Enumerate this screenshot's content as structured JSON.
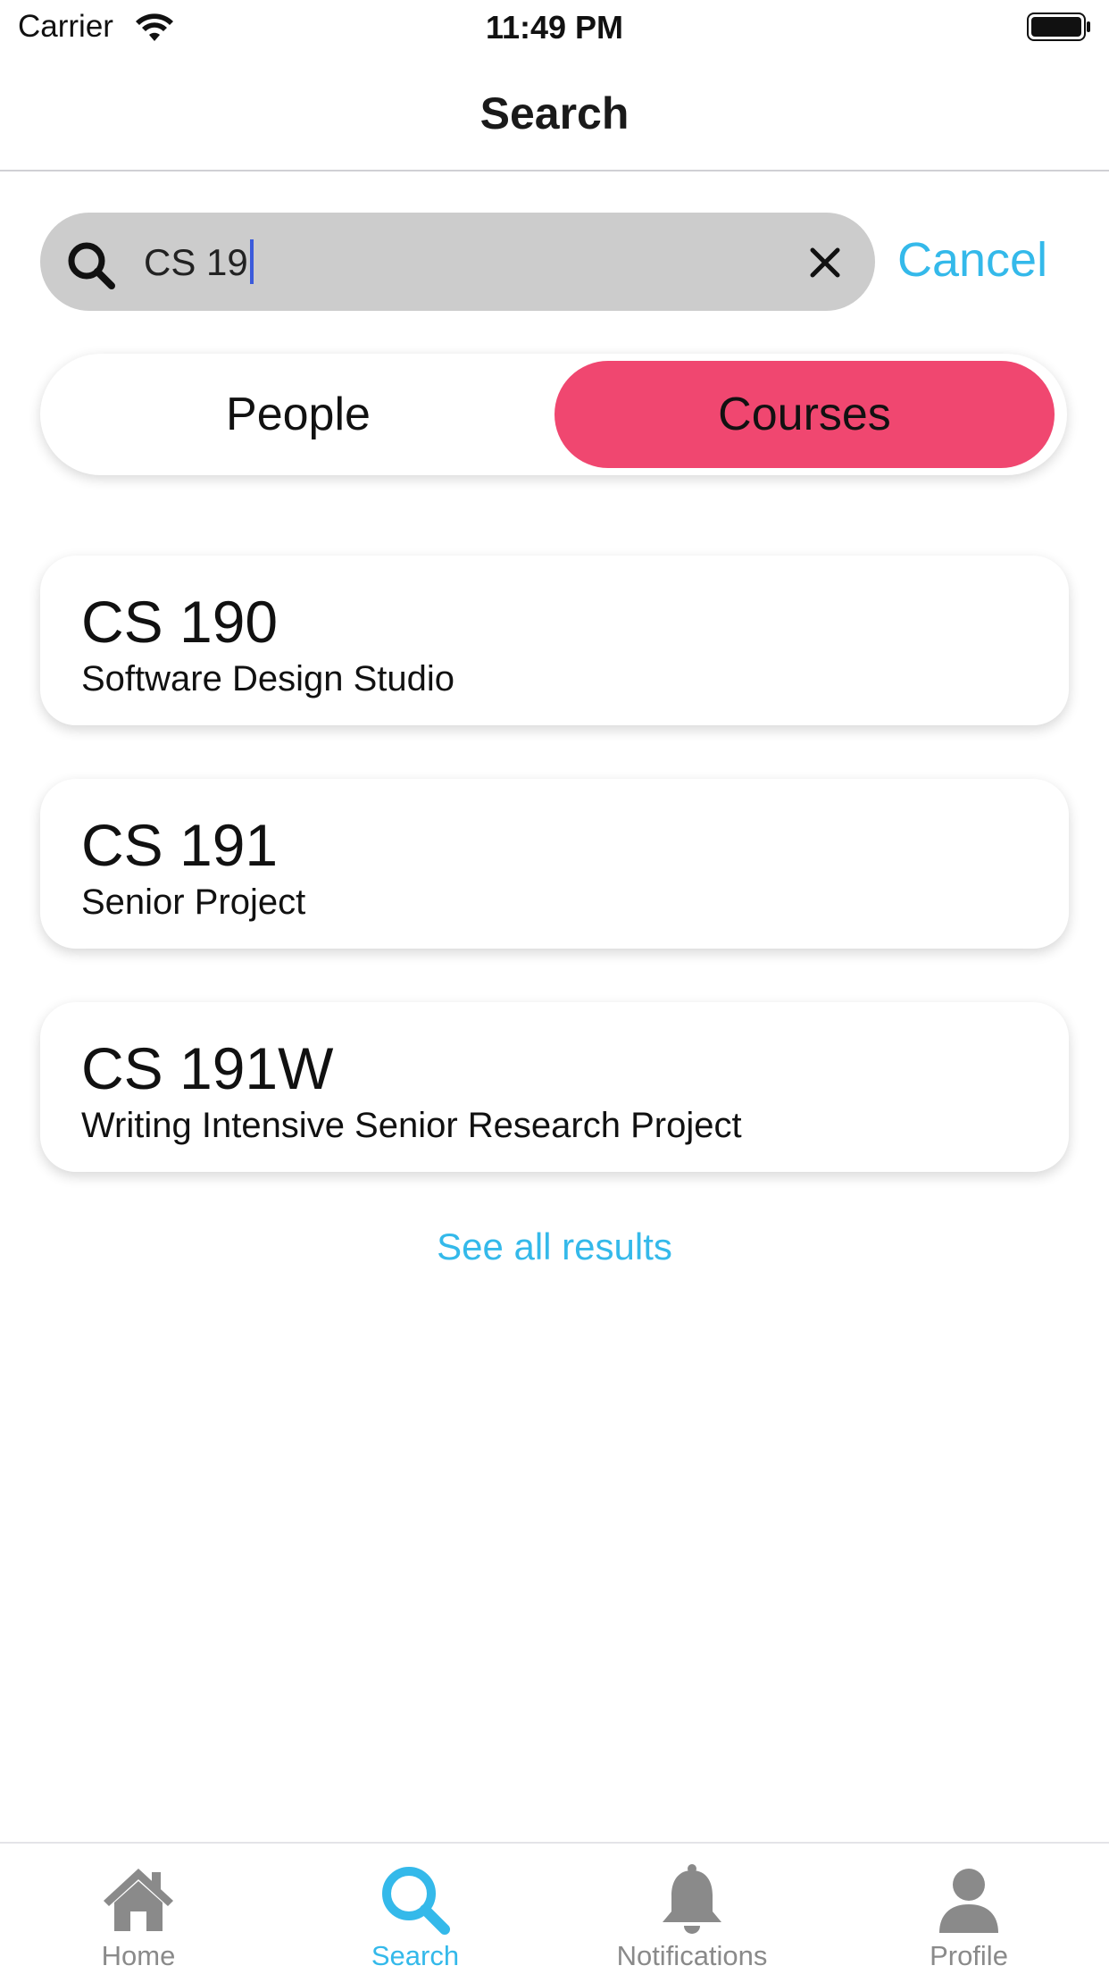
{
  "status_bar": {
    "carrier": "Carrier",
    "time": "11:49 PM"
  },
  "nav": {
    "title": "Search"
  },
  "search": {
    "value": "CS 19",
    "cancel_label": "Cancel"
  },
  "segments": {
    "people_label": "People",
    "courses_label": "Courses",
    "selected": "Courses"
  },
  "results": [
    {
      "code": "CS 190",
      "name": "Software Design Studio"
    },
    {
      "code": "CS 191",
      "name": "Senior Project"
    },
    {
      "code": "CS 191W",
      "name": "Writing Intensive Senior Research Project"
    }
  ],
  "see_all_label": "See all results",
  "tab_bar": {
    "tabs": [
      {
        "label": "Home",
        "icon": "house-icon"
      },
      {
        "label": "Search",
        "icon": "search-icon"
      },
      {
        "label": "Notifications",
        "icon": "bell-icon"
      },
      {
        "label": "Profile",
        "icon": "person-icon"
      }
    ],
    "active": "Search"
  },
  "colors": {
    "accent": "#34b9ea",
    "selected_segment": "#f04770",
    "search_field": "#cccccc",
    "inactive_tab": "#8a8a8a"
  }
}
